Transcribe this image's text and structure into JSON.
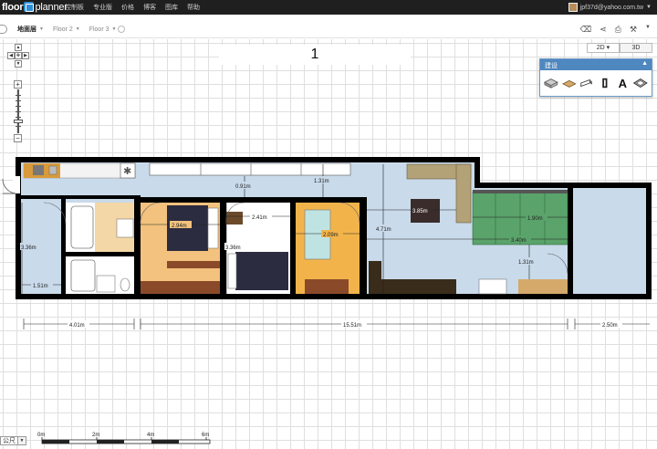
{
  "app": {
    "logo_floor": "floor",
    "logo_planner": "planner"
  },
  "nav": [
    "控制板",
    "专业版",
    "价格",
    "博客",
    "图库",
    "帮助"
  ],
  "user": {
    "email": "jpf37d@yahoo.com.tw"
  },
  "floors": [
    {
      "label": "地面层",
      "active": true
    },
    {
      "label": "Floor 2",
      "active": false
    },
    {
      "label": "Floor 3",
      "active": false
    }
  ],
  "view": {
    "mode_2d": "2D",
    "mode_3d": "3D"
  },
  "page_title": "1",
  "build_panel": {
    "title": "建设",
    "collapse": "▲"
  },
  "dimensions": {
    "d091": "0.91m",
    "d131a": "1.31m",
    "d294": "2.94m",
    "d241": "2.41m",
    "d385": "3.85m",
    "d190": "1.90m",
    "d336a": "3.36m",
    "d336b": "3.36m",
    "d209": "2.09m",
    "d471": "4.71m",
    "d340": "3.40m",
    "d131b": "1.31m",
    "d151": "1.51m",
    "d401": "4.01m",
    "d1551": "15.51m",
    "d250": "2.50m"
  },
  "scale": {
    "unit": "公尺",
    "labels": [
      "0m",
      "2m",
      "4m",
      "6m"
    ]
  },
  "colors": {
    "accent": "#4f87bf",
    "wall": "#000000",
    "floor": "#c9daea"
  }
}
